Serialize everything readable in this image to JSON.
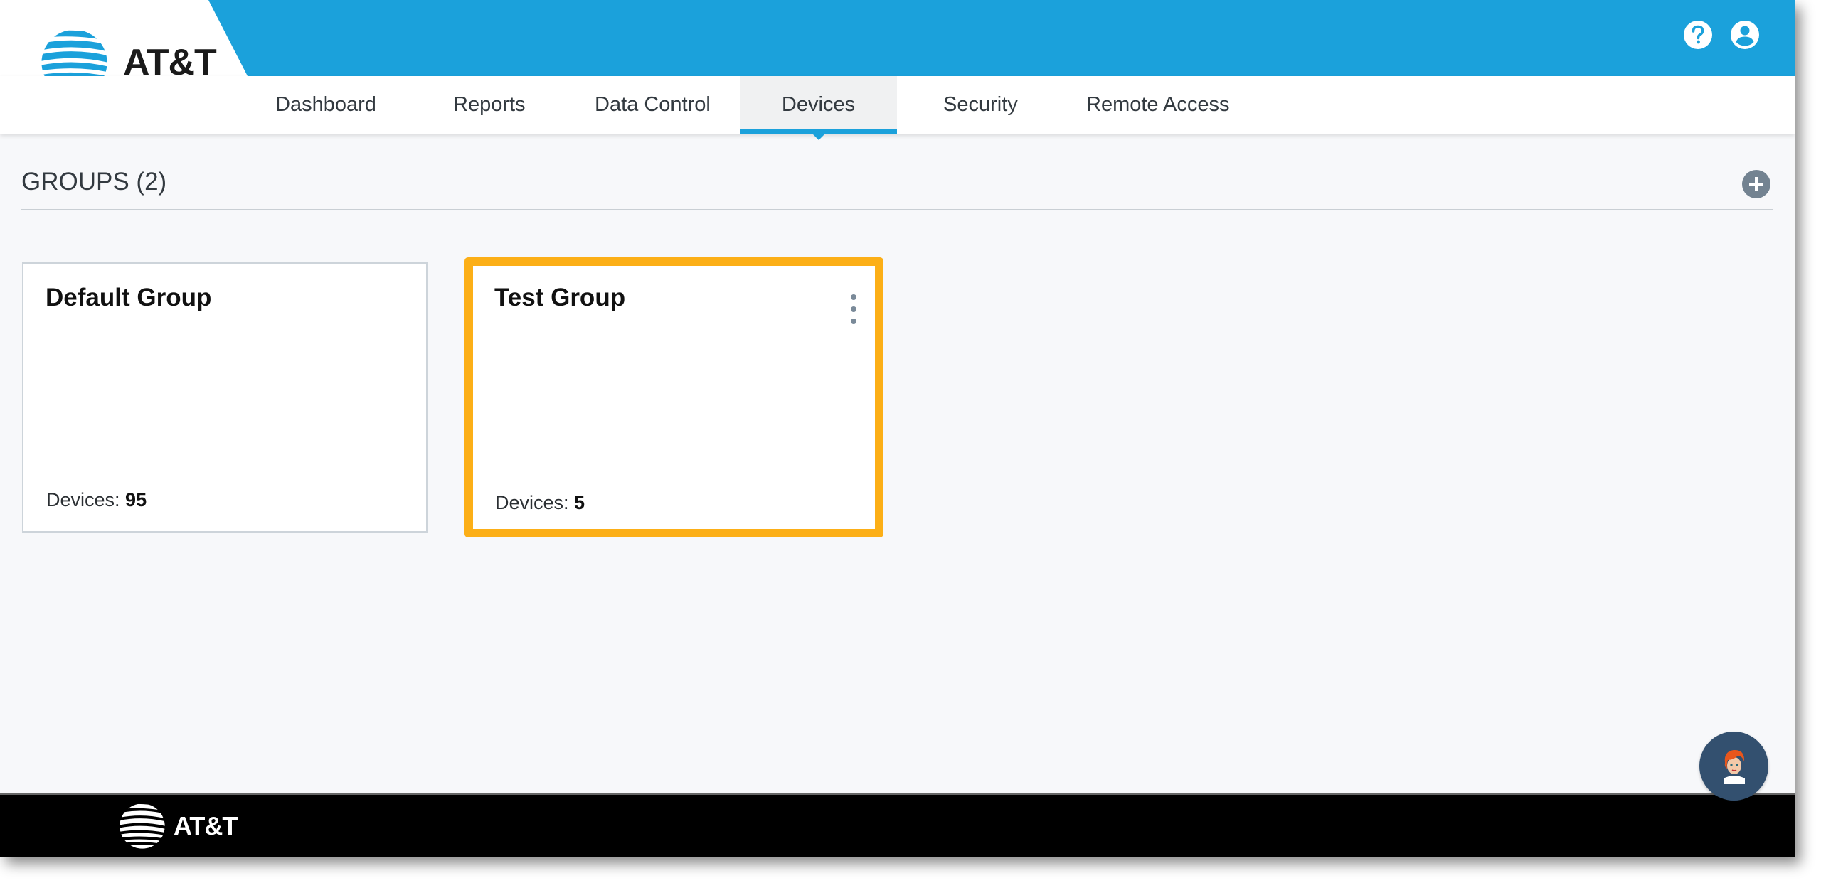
{
  "brand": {
    "name": "AT&T",
    "primary_color": "#1ba1db",
    "highlight_color": "#fcaf17"
  },
  "header": {
    "icons": [
      {
        "name": "help-icon",
        "label": "?"
      },
      {
        "name": "account-icon",
        "label": ""
      }
    ]
  },
  "nav": {
    "tabs": [
      {
        "label": "Dashboard",
        "active": false
      },
      {
        "label": "Reports",
        "active": false
      },
      {
        "label": "Data Control",
        "active": false
      },
      {
        "label": "Devices",
        "active": true
      },
      {
        "label": "Security",
        "active": false
      },
      {
        "label": "Remote Access",
        "active": false
      }
    ]
  },
  "groups": {
    "title": "GROUPS (2)",
    "add_icon": "plus-circle-icon",
    "cards": [
      {
        "name": "Default Group",
        "devices_label": "Devices:",
        "devices_count": "95",
        "selected": false,
        "has_menu": false
      },
      {
        "name": "Test Group",
        "devices_label": "Devices:",
        "devices_count": "5",
        "selected": true,
        "has_menu": true
      }
    ]
  },
  "chat": {
    "icon": "chat-assistant-avatar-icon"
  },
  "footer": {
    "brand": "AT&T"
  }
}
